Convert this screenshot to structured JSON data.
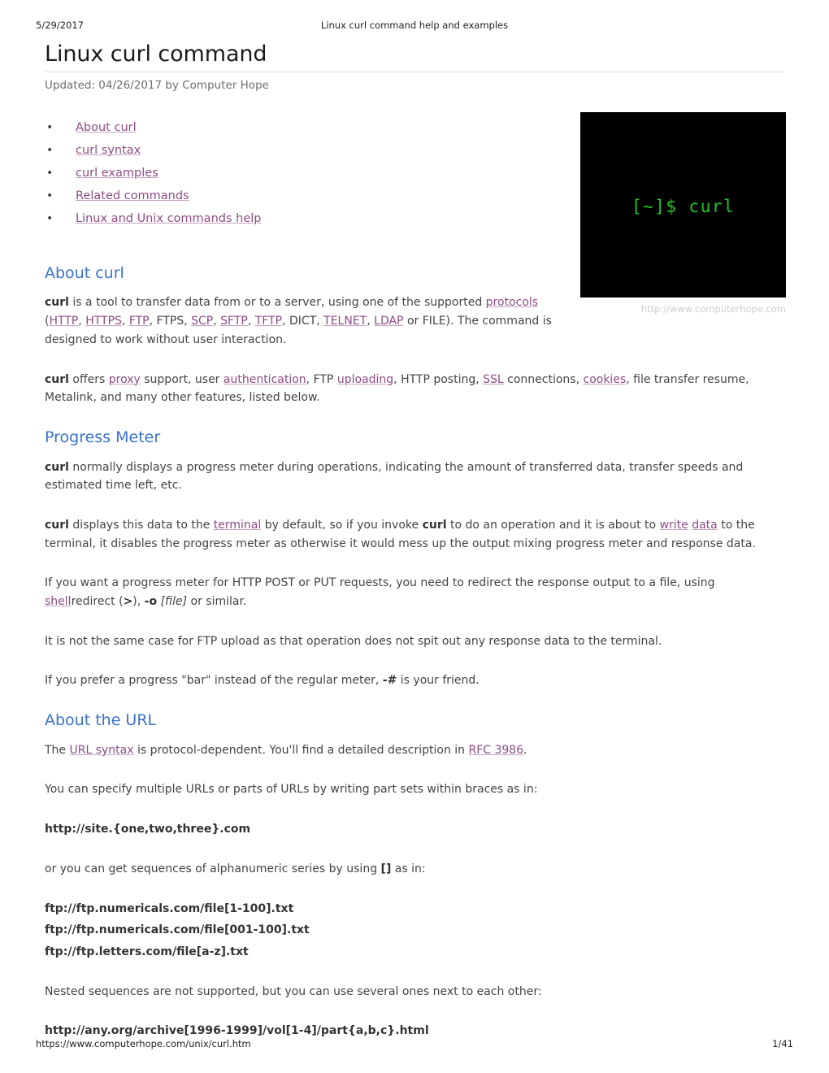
{
  "print": {
    "date": "5/29/2017",
    "header_title": "Linux curl command help and examples",
    "footer_url": "https://www.computerhope.com/unix/curl.htm",
    "page_number": "1/41"
  },
  "document": {
    "title": "Linux curl command",
    "updated": "Updated: 04/26/2017 by Computer Hope"
  },
  "toc": {
    "items": [
      {
        "label": "About curl"
      },
      {
        "label": "curl syntax"
      },
      {
        "label": "curl examples"
      },
      {
        "label": "Related commands"
      },
      {
        "label": "Linux and Unix commands help"
      }
    ]
  },
  "figure": {
    "terminal_text": "[~]$ curl",
    "caption": "http://www.computerhope.com",
    "bg_color": "#000000",
    "text_color": "#21c521"
  },
  "sections": {
    "about_curl": {
      "heading": "About curl",
      "p1": {
        "curl": "curl",
        "t1": " is a tool to transfer data from or to a server, using one of the supported ",
        "protocols": "protocols",
        "t2": " (",
        "http": "HTTP",
        "t3": ", ",
        "https": "HTTPS",
        "t4": ", ",
        "ftp": "FTP",
        "t5": ", FTPS, ",
        "scp": "SCP",
        "t6": ", ",
        "sftp": "SFTP",
        "t7": ", ",
        "tftp": "TFTP",
        "t8": ", DICT, ",
        "telnet": "TELNET",
        "t9": ", ",
        "ldap": "LDAP",
        "t10": " or FILE). The command is designed to work without user interaction."
      },
      "p2": {
        "curl": "curl",
        "t1": " offers ",
        "proxy": "proxy",
        "t2": " support, user ",
        "authentication": "authentication",
        "t3": ", FTP ",
        "uploading": "uploading",
        "t4": ", HTTP posting, ",
        "ssl": "SSL",
        "t5": " connections, ",
        "cookies": "cookies",
        "t6": ", file transfer resume, Metalink, and many other features, listed below."
      }
    },
    "progress_meter": {
      "heading": "Progress Meter",
      "p1": {
        "curl": "curl",
        "t1": " normally displays a progress meter during operations, indicating the amount of transferred data, transfer speeds and estimated time left, etc."
      },
      "p2": {
        "curl": "curl",
        "t1": " displays this data to the ",
        "terminal": "terminal",
        "t2": " by default, so if you invoke ",
        "curl2": "curl",
        "t3": " to do an operation and it is about to ",
        "write": "write",
        "t4": " ",
        "data": "data",
        "t5": " to the terminal, it disables the progress meter as otherwise it would mess up the output mixing progress meter and response data."
      },
      "p3": {
        "t1": "If you want a progress meter for HTTP POST or PUT requests, you need to redirect the response output to a file, using ",
        "shell": "shell",
        "t2": "redirect (",
        "gt": ">",
        "t3": "), ",
        "opt_o": "-o",
        "t4": " ",
        "file": "[file]",
        "t5": " or similar."
      },
      "p4": {
        "t1": "It is not the same case for FTP upload as that operation does not spit out any response data to the terminal."
      },
      "p5": {
        "t1": "If you prefer a progress \"bar\" instead of the regular meter, ",
        "opt_hash": "-#",
        "t2": " is your friend."
      }
    },
    "about_the_url": {
      "heading": "About the URL",
      "p1": {
        "t1": "The ",
        "url_syntax": "URL syntax",
        "t2": " is protocol-dependent. You'll find a detailed description in ",
        "rfc": "RFC 3986",
        "t3": "."
      },
      "p2": {
        "t1": "You can specify multiple URLs or parts of URLs by writing part sets within braces as in:"
      },
      "code1": "http://site.{one,two,three}.com",
      "p3": {
        "t1": "or you can get sequences of alphanumeric series by using ",
        "brackets": "[]",
        "t2": " as in:"
      },
      "code2": "ftp://ftp.numericals.com/file[1-100].txt",
      "code3": "ftp://ftp.numericals.com/file[001-100].txt",
      "code4": "ftp://ftp.letters.com/file[a-z].txt",
      "p4": {
        "t1": "Nested sequences are not supported, but you can use several ones next to each other:"
      },
      "code5": "http://any.org/archive[1996-1999]/vol[1-4]/part{a,b,c}.html"
    }
  },
  "colors": {
    "link": "#8d4b86",
    "heading": "#3a72c8",
    "body_text": "#444444",
    "rule": "#d9d9d9"
  }
}
